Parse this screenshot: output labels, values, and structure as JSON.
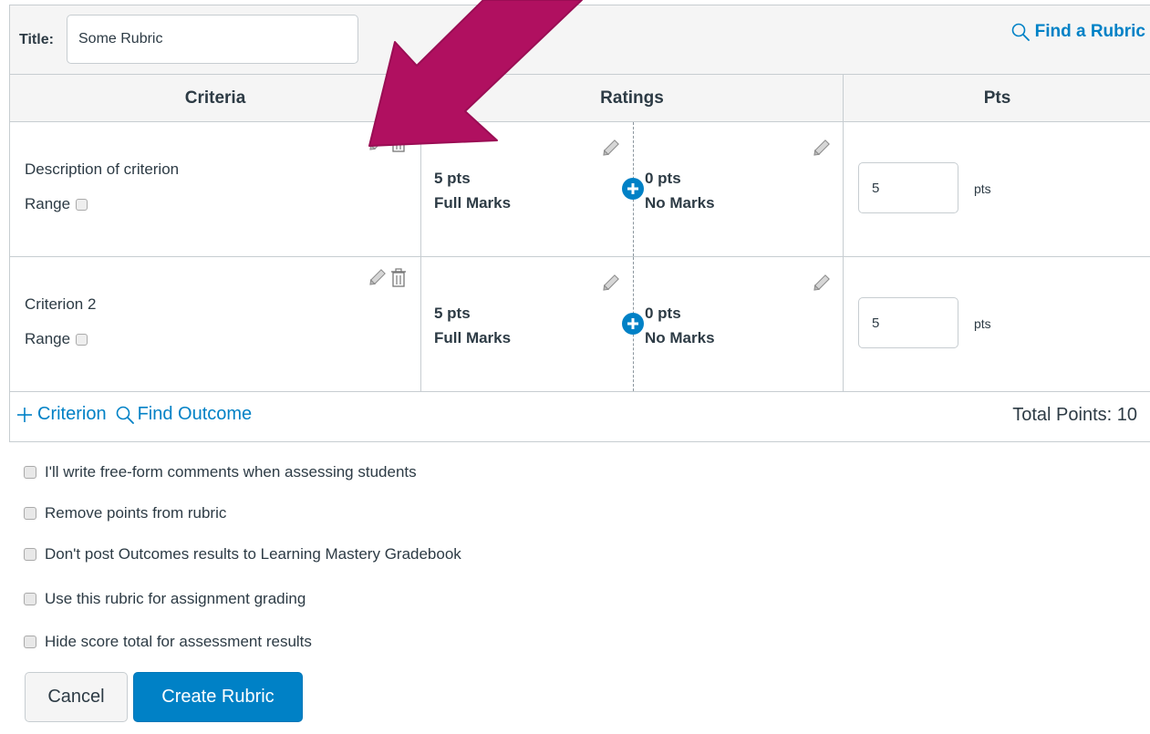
{
  "header": {
    "title_label": "Title:",
    "title_value": "Some Rubric",
    "find_rubric": "Find a Rubric"
  },
  "table": {
    "columns": [
      "Criteria",
      "Ratings",
      "Pts"
    ],
    "criteria": [
      {
        "description": "Description of criterion",
        "range_label": "Range",
        "ratings": [
          {
            "points": "5 pts",
            "description": "Full Marks"
          },
          {
            "points": "0 pts",
            "description": "No Marks"
          }
        ],
        "points_value": "5",
        "points_unit": "pts"
      },
      {
        "description": "Criterion 2",
        "range_label": "Range",
        "ratings": [
          {
            "points": "5 pts",
            "description": "Full Marks"
          },
          {
            "points": "0 pts",
            "description": "No Marks"
          }
        ],
        "points_value": "5",
        "points_unit": "pts"
      }
    ]
  },
  "footer": {
    "add_criterion": "Criterion",
    "find_outcome": "Find Outcome",
    "total_points": "Total Points: 10"
  },
  "options": [
    "I'll write free-form comments when assessing students",
    "Remove points from rubric",
    "Don't post Outcomes results to Learning Mastery Gradebook",
    "Use this rubric for assignment grading",
    "Hide score total for assessment results"
  ],
  "actions": {
    "cancel": "Cancel",
    "create": "Create Rubric"
  },
  "colors": {
    "link_blue": "#0081c6",
    "arrow": "#b01060",
    "text": "#2d3b45",
    "border": "#c7cdd1"
  },
  "icons": {
    "find": "magnifier-icon",
    "edit": "pencil-icon",
    "delete": "trash-icon",
    "add_rating": "plus-circle-icon",
    "add_criterion": "plus-icon",
    "annotation": "arrow-icon"
  }
}
